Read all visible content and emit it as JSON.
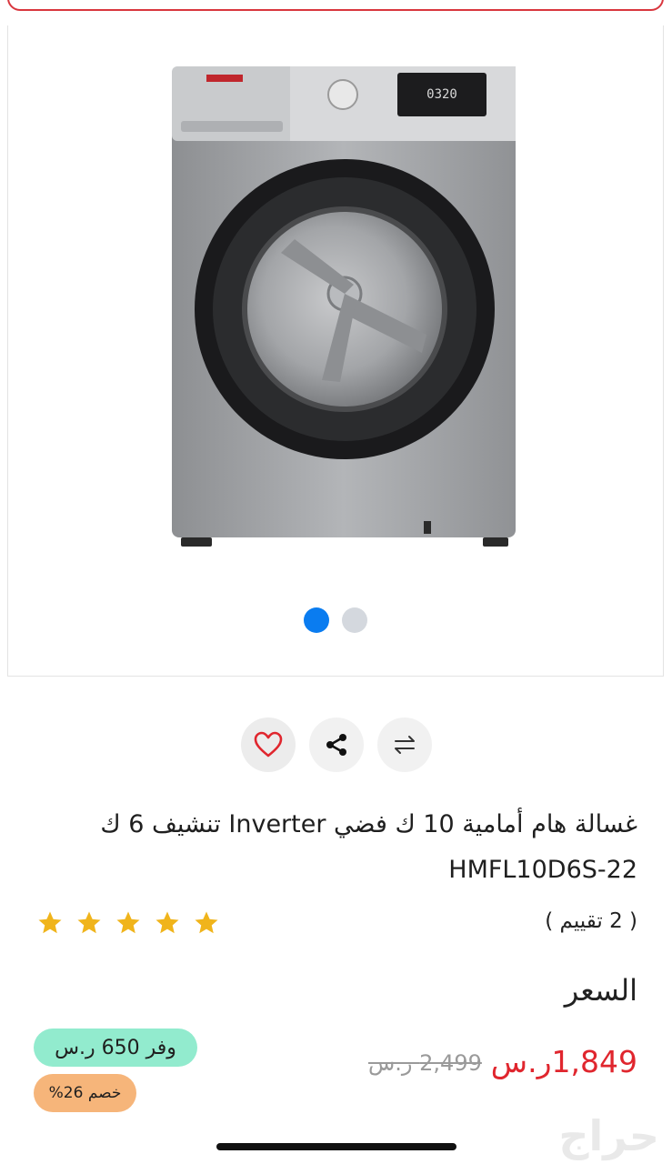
{
  "product": {
    "title": "غسالة هام أمامية 10 ك فضي Inverter تنشيف 6 ك HMFL10D6S-22",
    "rating_count": "( 2 تقييم )",
    "stars": 5,
    "price_label": "السعر",
    "price_now": "1,849ر.س",
    "price_old": "2,499 ر.س",
    "save_badge": "وفر 650 ر.س",
    "discount_badge": "خصم 26%"
  },
  "washer_display": "0320",
  "gallery": {
    "slides": 2,
    "active_index": 0
  },
  "watermark": "حراج",
  "colors": {
    "accent_blue": "#0a7cf0",
    "price_red": "#e0262e",
    "star_gold": "#f0b41b",
    "save_green": "#92ebce",
    "discount_orange": "#f6b57a"
  },
  "icons": [
    "heart-icon",
    "share-icon",
    "compare-icon",
    "star-icon"
  ]
}
